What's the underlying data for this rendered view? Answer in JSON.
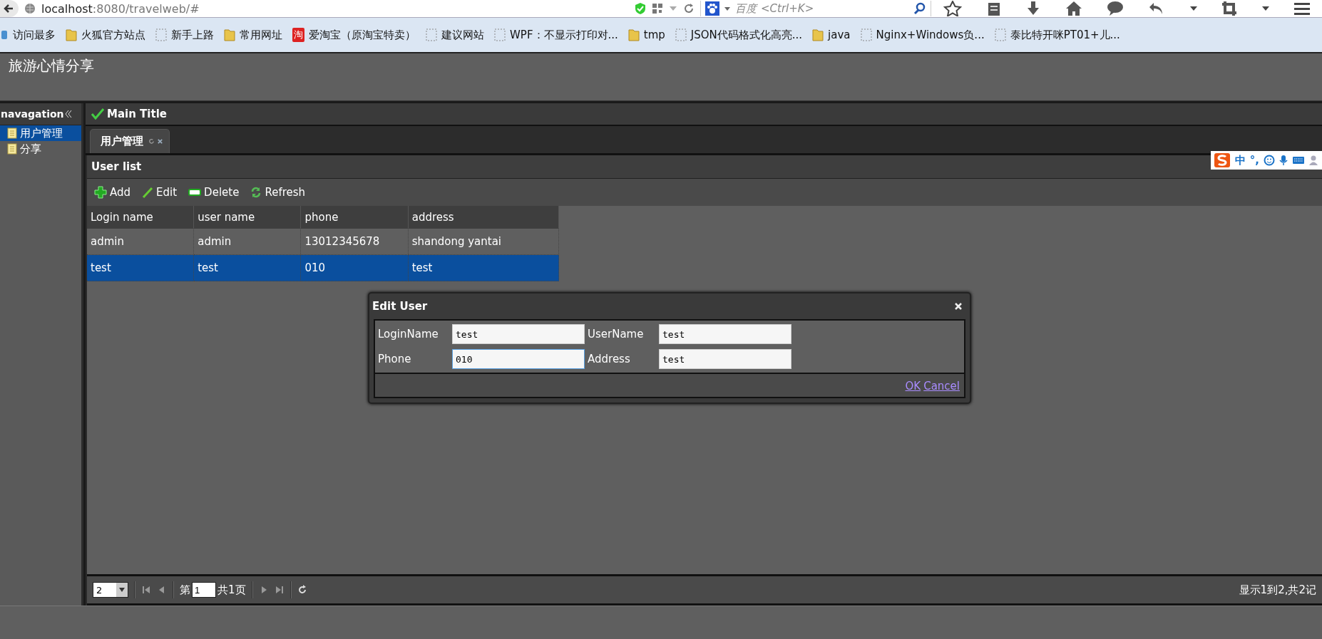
{
  "browser": {
    "url_host": "localhost",
    "url_rest": ":8080/travelweb/#",
    "search_engine": "百度",
    "search_placeholder": "<Ctrl+K>"
  },
  "bookmarks": [
    {
      "kind": "special",
      "label": "访问最多"
    },
    {
      "kind": "folder",
      "label": "火狐官方站点"
    },
    {
      "kind": "page",
      "label": "新手上路"
    },
    {
      "kind": "folder",
      "label": "常用网址"
    },
    {
      "kind": "taobao",
      "badge": "淘",
      "label": "爱淘宝（原淘宝特卖）"
    },
    {
      "kind": "page",
      "label": "建议网站"
    },
    {
      "kind": "page",
      "label": "WPF：不显示打印对..."
    },
    {
      "kind": "folder",
      "label": "tmp"
    },
    {
      "kind": "page",
      "label": "JSON代码格式化高亮..."
    },
    {
      "kind": "folder",
      "label": "java"
    },
    {
      "kind": "page",
      "label": "Nginx+Windows负..."
    },
    {
      "kind": "page",
      "label": "泰比特开咪PT01+儿..."
    }
  ],
  "app_title": "旅游心情分享",
  "nav": {
    "title": "navagation",
    "items": [
      {
        "label": "用户管理",
        "selected": true
      },
      {
        "label": "分享",
        "selected": false
      }
    ]
  },
  "main_title": "Main Title",
  "tabs": [
    {
      "label": "用户管理",
      "selected": true
    }
  ],
  "panel_title": "User list",
  "toolbar": [
    {
      "kind": "add",
      "label": "Add"
    },
    {
      "kind": "edit",
      "label": "Edit"
    },
    {
      "kind": "delete",
      "label": "Delete"
    },
    {
      "kind": "refresh",
      "label": "Refresh"
    }
  ],
  "table": {
    "columns": [
      "Login name",
      "user name",
      "phone",
      "address"
    ],
    "rows": [
      {
        "cells": [
          "admin",
          "admin",
          "13012345678",
          "shandong yantai"
        ],
        "selected": false
      },
      {
        "cells": [
          "test",
          "test",
          "010",
          "test"
        ],
        "selected": true
      }
    ]
  },
  "ime": {
    "texts": [
      "中",
      "°,"
    ]
  },
  "dialog": {
    "title": "Edit User",
    "fields": [
      {
        "label": "LoginName",
        "value": "test",
        "focused": false
      },
      {
        "label": "UserName",
        "value": "test",
        "focused": false
      },
      {
        "label": "Phone",
        "value": "010",
        "focused": true
      },
      {
        "label": "Address",
        "value": "test",
        "focused": false
      }
    ],
    "buttons": [
      "OK",
      "Cancel"
    ]
  },
  "pager": {
    "page_size": "2",
    "page_prefix": "第",
    "page": "1",
    "page_suffix": "共1页",
    "summary": "显示1到2,共2记"
  }
}
